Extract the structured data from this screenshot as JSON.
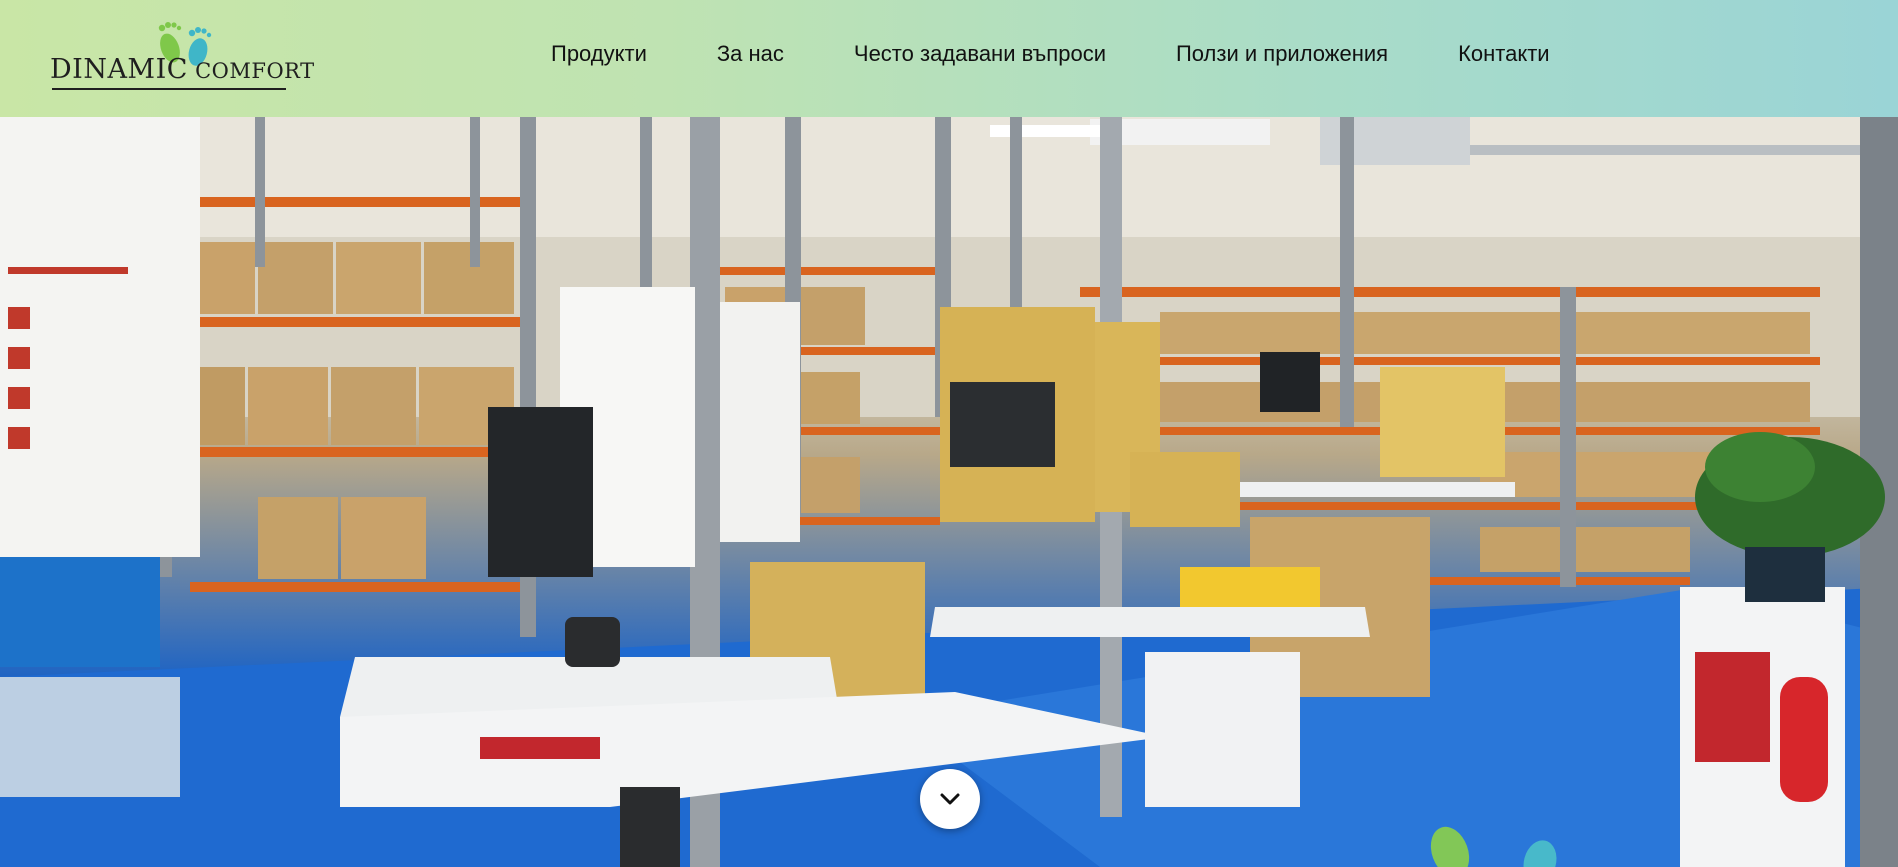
{
  "logo": {
    "text_main": "DINAMIC",
    "text_secondary": "COMFORT"
  },
  "nav": {
    "items": [
      {
        "label": "Продукти"
      },
      {
        "label": "За нас"
      },
      {
        "label": "Често задавани въпроси"
      },
      {
        "label": "Ползи и приложения"
      },
      {
        "label": "Контакти"
      }
    ]
  },
  "hero": {
    "image": "warehouse-workspace-photo",
    "scroll_icon": "chevron-down-icon"
  },
  "colors": {
    "header_start": "#c9e6a6",
    "header_end": "#9ad4d6",
    "floor_blue": "#1f6ad0",
    "shelf_orange": "#d9641f",
    "box_kraft": "#c9a26a",
    "logo_foot_green": "#7fc84a",
    "logo_foot_teal": "#3fb6c8"
  }
}
